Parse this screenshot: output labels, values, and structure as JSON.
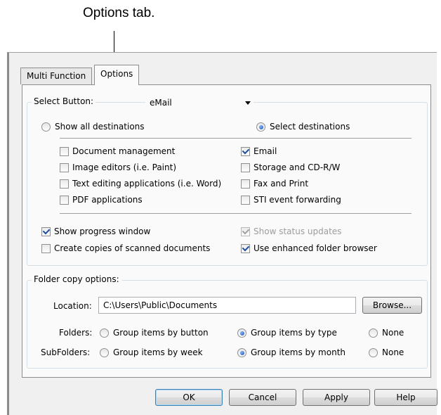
{
  "callout": "Options tab.",
  "tabs": [
    {
      "label": "Multi Function",
      "active": false
    },
    {
      "label": "Options",
      "active": true
    }
  ],
  "select_button": {
    "label": "Select Button:",
    "value": "eMail"
  },
  "destinations": {
    "show_all": {
      "label": "Show all destinations",
      "selected": false
    },
    "select": {
      "label": "Select destinations",
      "selected": true
    },
    "left_items": [
      {
        "label": "Document management",
        "checked": false
      },
      {
        "label": "Image editors (i.e. Paint)",
        "checked": false
      },
      {
        "label": "Text editing applications (i.e. Word)",
        "checked": false
      },
      {
        "label": "PDF applications",
        "checked": false
      }
    ],
    "right_items": [
      {
        "label": "Email",
        "checked": true
      },
      {
        "label": "Storage and CD-R/W",
        "checked": false
      },
      {
        "label": "Fax and Print",
        "checked": false
      },
      {
        "label": "STI event forwarding",
        "checked": false
      }
    ]
  },
  "options": {
    "show_progress": {
      "label": "Show progress window",
      "checked": true
    },
    "show_status": {
      "label": "Show status updates",
      "checked": true,
      "disabled": true
    },
    "create_copies": {
      "label": "Create copies of scanned documents",
      "checked": false
    },
    "enhanced_browser": {
      "label": "Use enhanced folder browser",
      "checked": true
    }
  },
  "folder_copy": {
    "legend": "Folder copy options:",
    "location_label": "Location:",
    "location_value": "C:\\Users\\Public\\Documents",
    "browse": "Browse...",
    "folders_label": "Folders:",
    "folders_options": [
      "Group items by button",
      "Group items by type",
      "None"
    ],
    "folders_selected": 1,
    "subfolders_label": "SubFolders:",
    "subfolders_options": [
      "Group items by week",
      "Group items by month",
      "None"
    ],
    "subfolders_selected": 1
  },
  "buttons": {
    "ok": "OK",
    "cancel": "Cancel",
    "apply": "Apply",
    "help": "Help"
  }
}
